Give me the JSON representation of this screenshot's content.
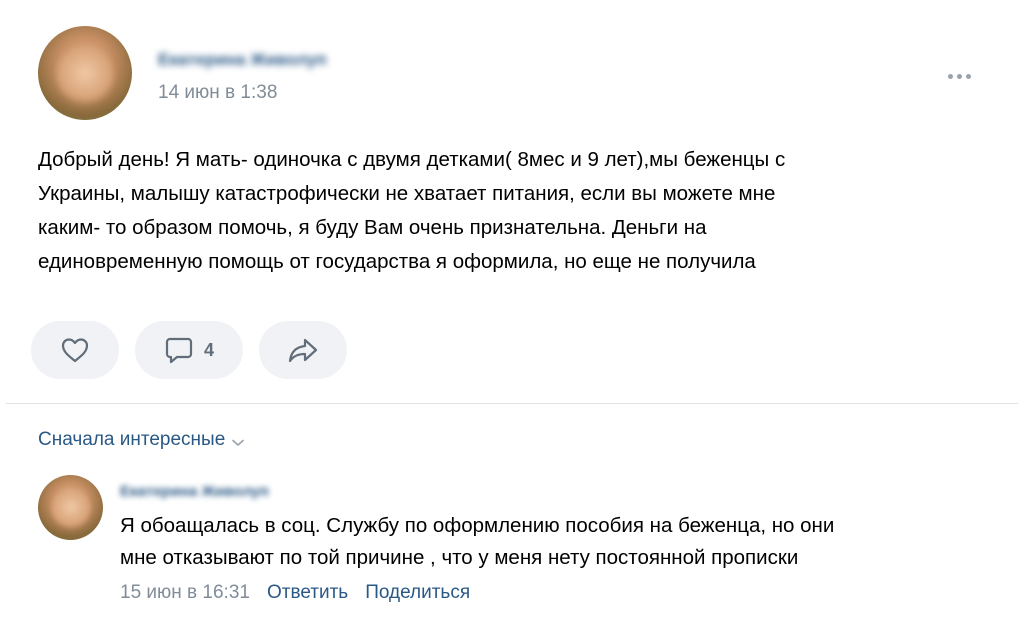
{
  "post": {
    "author": "Екатерина Живолуп",
    "date": "14 июн в 1:38",
    "text_lines": [
      "Добрый день! Я мать- одиночка с двумя детками( 8мес и 9 лет),мы беженцы с",
      "Украины, малышу катастрофически не хватает питания, если вы можете мне",
      "каким- то образом помочь, я буду Вам очень признательна. Деньги на",
      "единовременную помощь от государства я оформила, но еще не получила"
    ],
    "comment_count": "4"
  },
  "comments_section": {
    "sort_label": "Сначала интересные"
  },
  "comment": {
    "author": "Екатерина Живолуп",
    "text_lines": [
      "Я обоащалась в соц. Службу по оформлению пособия на беженца, но они",
      "мне отказывают по той причине , что у меня нету постоянной прописки"
    ],
    "date": "15 июн в 16:31",
    "reply_label": "Ответить",
    "share_label": "Поделиться"
  },
  "icons": {
    "like": "heart-icon",
    "comment": "comment-bubble-icon",
    "share": "share-arrow-icon",
    "more": "more-dots-icon",
    "sort": "chevron-down-icon"
  },
  "colors": {
    "link": "#2a5885",
    "meta": "#818c99",
    "button_bg": "#f0f2f5",
    "icon": "#626d7a"
  }
}
